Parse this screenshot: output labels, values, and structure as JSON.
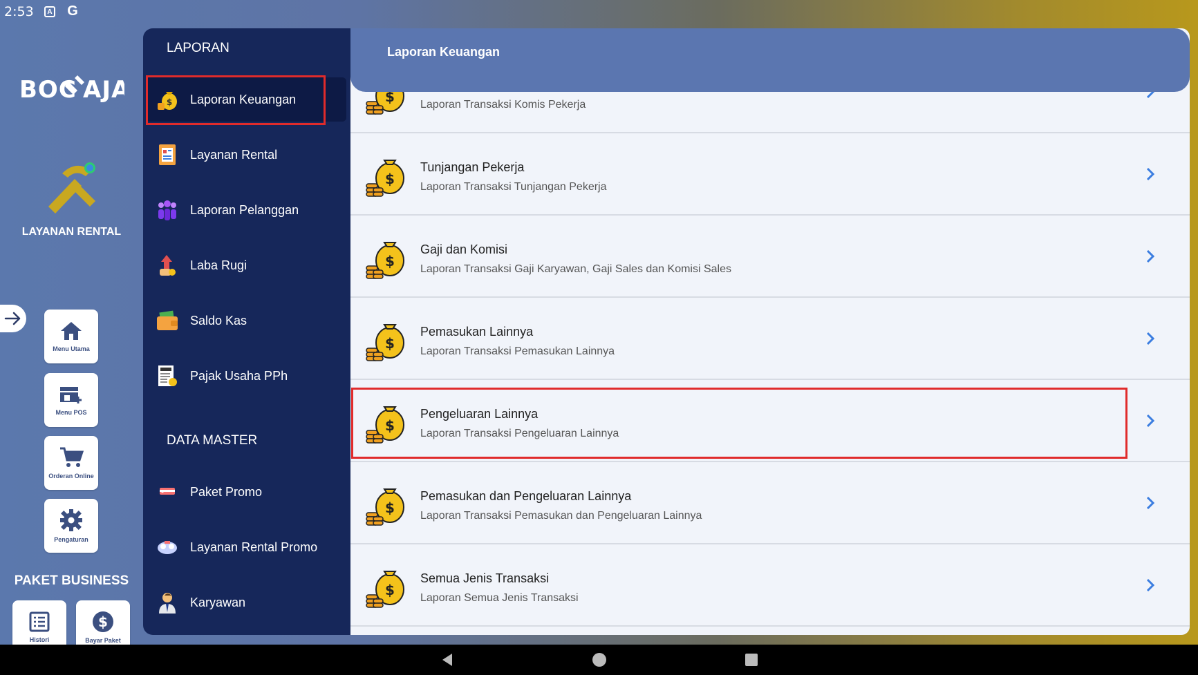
{
  "status_bar": {
    "time": "2:53",
    "icons": [
      "a-badge-icon",
      "google-icon"
    ],
    "google_glyph": "G",
    "a_glyph": "A"
  },
  "rail": {
    "logo_text": "BOC AJA",
    "title": "LAYANAN RENTAL",
    "tiles": [
      {
        "label": "Menu Utama",
        "icon": "home-icon"
      },
      {
        "label": "Menu POS",
        "icon": "store-add-icon"
      },
      {
        "label": "Orderan Online",
        "icon": "cart-icon"
      },
      {
        "label": "Pengaturan",
        "icon": "gear-icon"
      }
    ],
    "paket_title": "PAKET BUSINESS",
    "paket_tiles": [
      {
        "label": "Histori",
        "icon": "list-icon"
      },
      {
        "label": "Bayar Paket",
        "icon": "dollar-icon"
      }
    ]
  },
  "menu": {
    "section1": "LAPORAN",
    "items1": [
      {
        "label": "Laporan Keuangan",
        "icon": "money-bag-icon"
      },
      {
        "label": "Layanan Rental",
        "icon": "report-icon"
      },
      {
        "label": "Laporan Pelanggan",
        "icon": "customers-icon"
      },
      {
        "label": "Laba Rugi",
        "icon": "profit-icon"
      },
      {
        "label": "Saldo Kas",
        "icon": "wallet-icon"
      },
      {
        "label": "Pajak Usaha PPh",
        "icon": "tax-icon"
      }
    ],
    "section2": "DATA MASTER",
    "items2": [
      {
        "label": "Paket Promo",
        "icon": "promo-icon"
      },
      {
        "label": "Layanan Rental Promo",
        "icon": "rental-promo-icon"
      },
      {
        "label": "Karyawan",
        "icon": "employee-icon"
      }
    ]
  },
  "main": {
    "header_title": "Laporan Keuangan",
    "rows": [
      {
        "title": "",
        "subtitle": "Laporan Transaksi Komis Pekerja"
      },
      {
        "title": "Tunjangan Pekerja",
        "subtitle": "Laporan Transaksi Tunjangan Pekerja"
      },
      {
        "title": "Gaji dan Komisi",
        "subtitle": "Laporan Transaksi Gaji Karyawan, Gaji Sales dan Komisi Sales"
      },
      {
        "title": "Pemasukan Lainnya",
        "subtitle": "Laporan Transaksi Pemasukan Lainnya"
      },
      {
        "title": "Pengeluaran Lainnya",
        "subtitle": "Laporan Transaksi Pengeluaran Lainnya"
      },
      {
        "title": "Pemasukan dan Pengeluaran Lainnya",
        "subtitle": "Laporan Transaksi Pemasukan dan Pengeluaran Lainnya"
      },
      {
        "title": "Semua Jenis Transaksi",
        "subtitle": "Laporan Semua Jenis Transaksi"
      }
    ]
  },
  "colors": {
    "accent_blue": "#5b76b0",
    "menu_bg": "#16275a",
    "highlight_red": "#e02b2b",
    "chevron": "#3b7de0"
  }
}
